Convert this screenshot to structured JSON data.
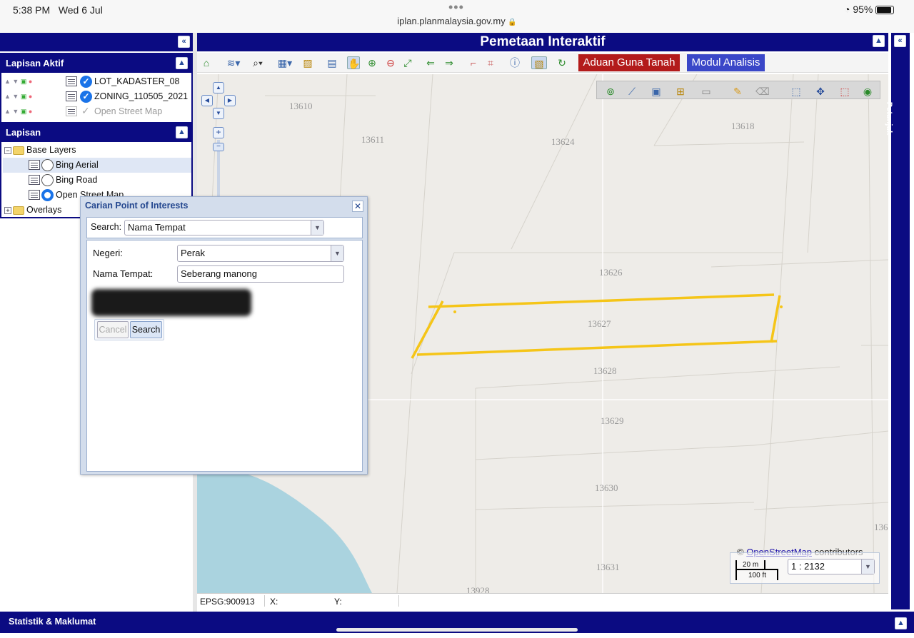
{
  "status_bar": {
    "time": "5:38 PM",
    "date": "Wed 6 Jul",
    "url": "iplan.planmalaysia.gov.my",
    "battery": "95%"
  },
  "left_panel": {
    "collapse_label": "«",
    "lapisan_aktif": {
      "title": "Lapisan Aktif",
      "layers": [
        {
          "name": "LOT_KADASTER_08",
          "checked": true
        },
        {
          "name": "ZONING_110505_2021",
          "checked": true
        },
        {
          "name": "Open Street Map",
          "checked": false
        }
      ]
    },
    "lapisan": {
      "title": "Lapisan",
      "base_layers_label": "Base Layers",
      "base_layers": [
        "Bing Aerial",
        "Bing Road",
        "Open Street Map"
      ],
      "selected_base_layer": "Open Street Map",
      "overlays_label": "Overlays"
    }
  },
  "map": {
    "title": "Pemetaan Interaktif",
    "aduan_button": "Aduan Guna Tanah",
    "modul_button": "Modul Analisis",
    "parcels": [
      "13610",
      "13611",
      "13624",
      "13618",
      "13626",
      "13627",
      "13628",
      "13629",
      "13630",
      "13631",
      "13928",
      "136"
    ],
    "attribution_prefix": "©",
    "attribution_link": "OpenStreetMap",
    "attribution_suffix": "contributors",
    "scale_m": "20 m",
    "scale_ft": "100 ft",
    "scale_ratio": "1 : 2132",
    "projection": "EPSG:900913",
    "x_label": "X:",
    "y_label": "Y:",
    "highlight_color": "#f5c518"
  },
  "right_strip": {
    "label": "Petunjuk",
    "collapse_label": "«"
  },
  "dialog": {
    "title": "Carian Point of Interests",
    "close_label": "✕",
    "search_label": "Search:",
    "search_type": "Nama Tempat",
    "negeri_label": "Negeri:",
    "negeri_value": "Perak",
    "nama_tempat_label": "Nama Tempat:",
    "nama_tempat_value": "Seberang manong",
    "cancel_label": "Cancel",
    "search_button": "Search"
  },
  "bottom": {
    "title": "Statistik & Maklumat"
  }
}
